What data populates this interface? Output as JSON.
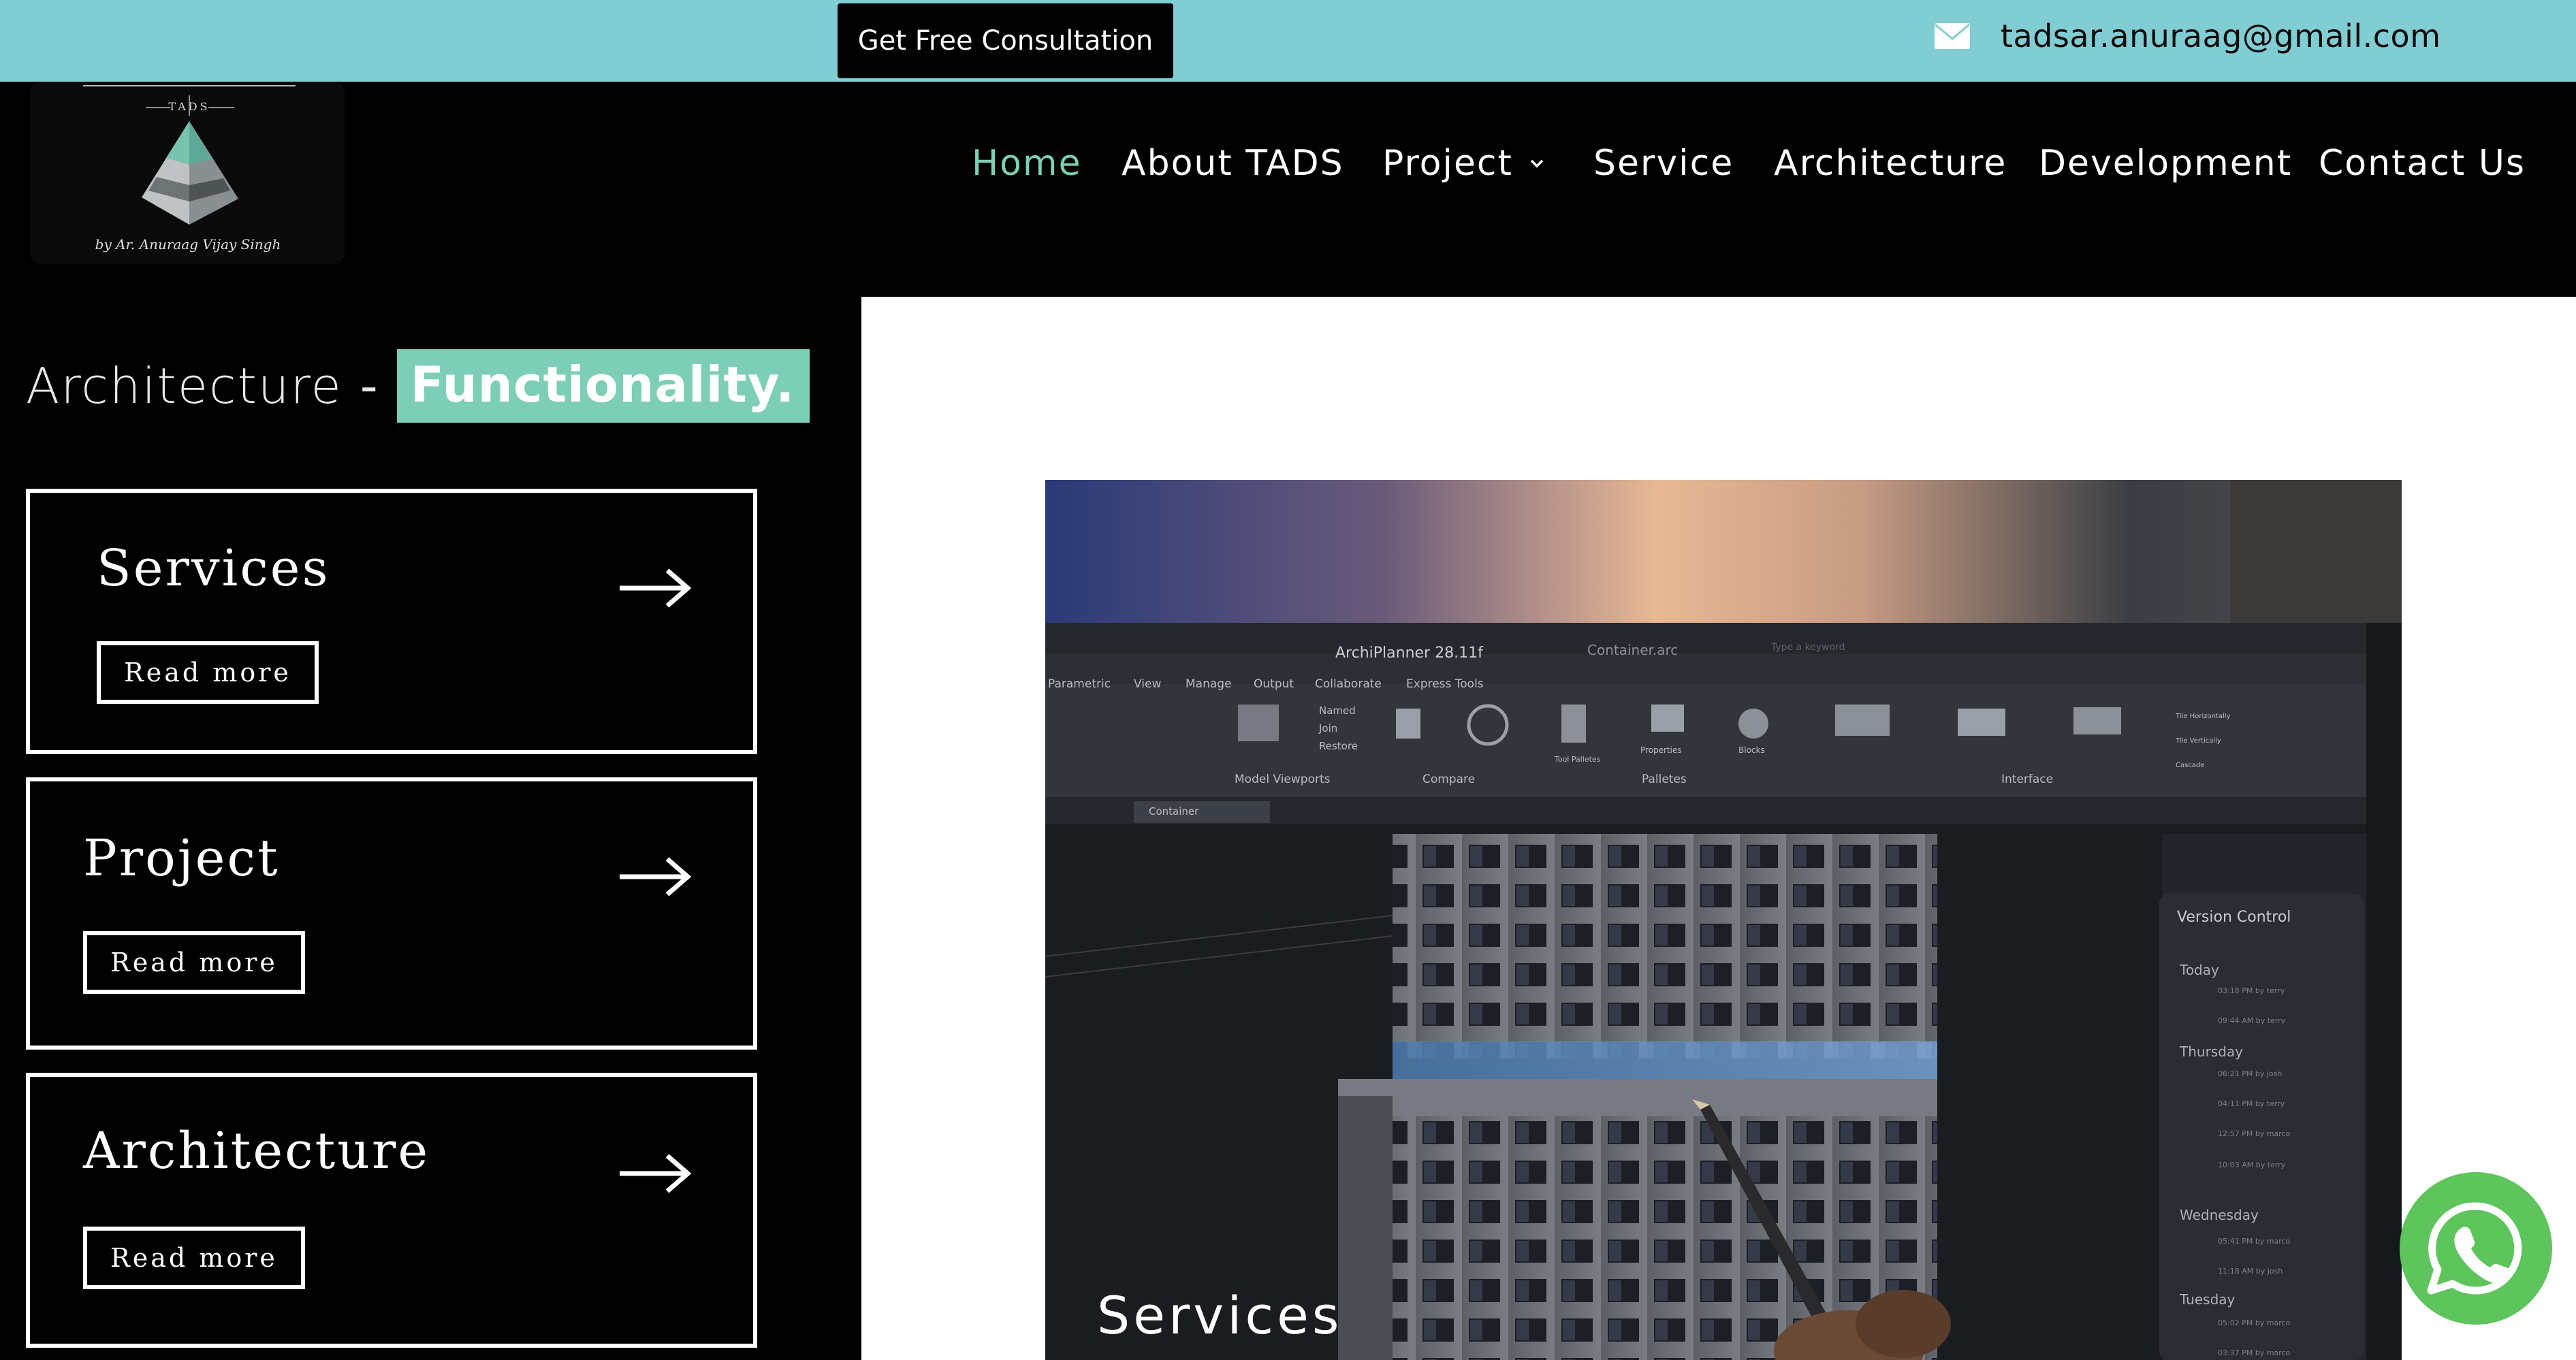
{
  "topbar": {
    "cta_label": "Get Free Consultation",
    "email": "tadsar.anuraag@gmail.com",
    "email_icon": "envelope-icon",
    "bg_color": "#80cdd3"
  },
  "logo": {
    "brand": "TADS",
    "signature": "by Ar. Anuraag Vijay Singh"
  },
  "nav": {
    "items": [
      {
        "label": "Home",
        "active": true
      },
      {
        "label": "About TADS"
      },
      {
        "label": "Project",
        "has_dropdown": true
      },
      {
        "label": "Service"
      },
      {
        "label": "Architecture"
      },
      {
        "label": "Development"
      },
      {
        "label": "Contact Us"
      }
    ],
    "active_color": "#7ccfb6"
  },
  "hero": {
    "title_plain": "Architecture",
    "title_dash": "-",
    "title_highlight": "Functionality."
  },
  "cards": [
    {
      "title": "Services",
      "button": "Read more"
    },
    {
      "title": "Project",
      "button": "Read more"
    },
    {
      "title": "Architecture",
      "button": "Read more"
    }
  ],
  "showcase": {
    "caption": "Services",
    "app": {
      "title": "ArchiPlanner 28.11f",
      "file": "Container.arc",
      "search_placeholder": "Type a keyword",
      "menu": [
        "Parametric",
        "View",
        "Manage",
        "Output",
        "Collaborate",
        "Express Tools"
      ],
      "ribbon_groups": [
        "Model Viewports",
        "Compare",
        "Palletes",
        "Interface"
      ],
      "ribbon_items": [
        "Named",
        "Join",
        "Restore",
        "Properties",
        "Blocks",
        "Tool Palletes",
        "Tile Horizontally",
        "Tile Vertically",
        "Cascade"
      ],
      "tabs": [
        "Container"
      ],
      "panel": {
        "title": "Version Control",
        "groups": [
          {
            "day": "Today",
            "entries": [
              "03:18 PM by terry",
              "09:44 AM by terry"
            ]
          },
          {
            "day": "Thursday",
            "entries": [
              "06:21 PM by josh",
              "04:11 PM by terry",
              "12:57 PM by marco",
              "10:03 AM by terry"
            ]
          },
          {
            "day": "Wednesday",
            "entries": [
              "05:41 PM by marco",
              "11:18 AM by josh"
            ]
          },
          {
            "day": "Tuesday",
            "entries": [
              "05:02 PM by marco",
              "03:37 PM by marco"
            ]
          }
        ]
      }
    }
  },
  "whatsapp": {
    "icon": "whatsapp-icon",
    "color": "#5ec45c"
  }
}
